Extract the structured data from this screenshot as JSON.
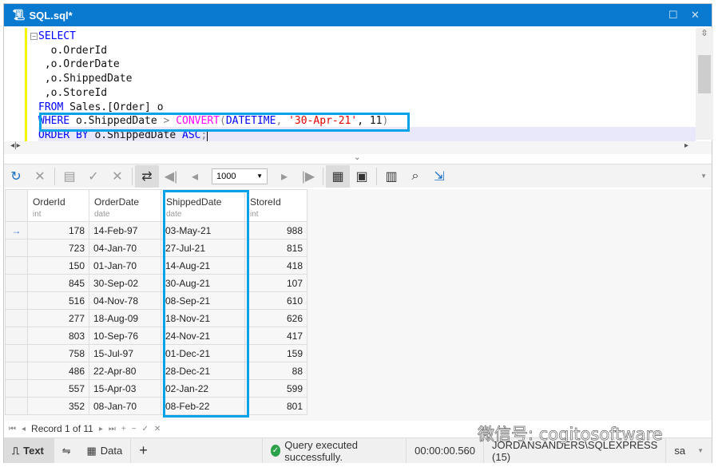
{
  "window": {
    "title": "SQL.sql*"
  },
  "editor": {
    "lines": [
      [
        {
          "t": "SELECT",
          "c": "kw"
        }
      ],
      [
        {
          "t": "  o.OrderId",
          "c": ""
        }
      ],
      [
        {
          "t": " ,o.OrderDate",
          "c": ""
        }
      ],
      [
        {
          "t": " ,o.ShippedDate",
          "c": ""
        }
      ],
      [
        {
          "t": " ,o.StoreId",
          "c": ""
        }
      ],
      [
        {
          "t": "FROM",
          "c": "kw"
        },
        {
          "t": " Sales.[Order] o",
          "c": ""
        }
      ],
      [
        {
          "t": "WHERE",
          "c": "kw"
        },
        {
          "t": " o.ShippedDate ",
          "c": ""
        },
        {
          "t": ">",
          "c": "op"
        },
        {
          "t": " ",
          "c": ""
        },
        {
          "t": "CONVERT",
          "c": "fn"
        },
        {
          "t": "(",
          "c": "op"
        },
        {
          "t": "DATETIME",
          "c": "kw"
        },
        {
          "t": ", ",
          "c": "op"
        },
        {
          "t": "'30-Apr-21'",
          "c": "str"
        },
        {
          "t": ", 11",
          "c": ""
        },
        {
          "t": ")",
          "c": "op"
        }
      ],
      [
        {
          "t": "ORDER BY",
          "c": "kw"
        },
        {
          "t": " o.ShippedDate ",
          "c": ""
        },
        {
          "t": "ASC",
          "c": "kw"
        },
        {
          "t": ";",
          "c": "op"
        }
      ]
    ]
  },
  "toolbar": {
    "max_rows": "1000"
  },
  "grid": {
    "columns": [
      {
        "name": "OrderId",
        "type": "int"
      },
      {
        "name": "OrderDate",
        "type": "date"
      },
      {
        "name": "ShippedDate",
        "type": "date"
      },
      {
        "name": "StoreId",
        "type": "int"
      }
    ],
    "rows": [
      [
        "178",
        "14-Feb-97",
        "03-May-21",
        "988"
      ],
      [
        "723",
        "04-Jan-70",
        "27-Jul-21",
        "815"
      ],
      [
        "150",
        "01-Jan-70",
        "14-Aug-21",
        "418"
      ],
      [
        "845",
        "30-Sep-02",
        "30-Aug-21",
        "107"
      ],
      [
        "516",
        "04-Nov-78",
        "08-Sep-21",
        "610"
      ],
      [
        "277",
        "18-Aug-09",
        "18-Nov-21",
        "626"
      ],
      [
        "803",
        "10-Sep-76",
        "24-Nov-21",
        "417"
      ],
      [
        "758",
        "15-Jul-97",
        "01-Dec-21",
        "159"
      ],
      [
        "486",
        "22-Apr-80",
        "28-Dec-21",
        "88"
      ],
      [
        "557",
        "15-Apr-03",
        "02-Jan-22",
        "599"
      ],
      [
        "352",
        "08-Jan-70",
        "08-Feb-22",
        "801"
      ]
    ]
  },
  "nav": {
    "record": "Record 1 of 11"
  },
  "status": {
    "text_tab": "Text",
    "data_tab": "Data",
    "message": "Query executed successfully.",
    "elapsed": "00:00:00.560",
    "server": "JORDANSANDERS\\SQLEXPRESS (15)",
    "user": "sa"
  },
  "watermark": "微信号: cogitosoftware",
  "colors": {
    "title_bar": "#0a7ad1",
    "highlight": "#00a3e8"
  }
}
